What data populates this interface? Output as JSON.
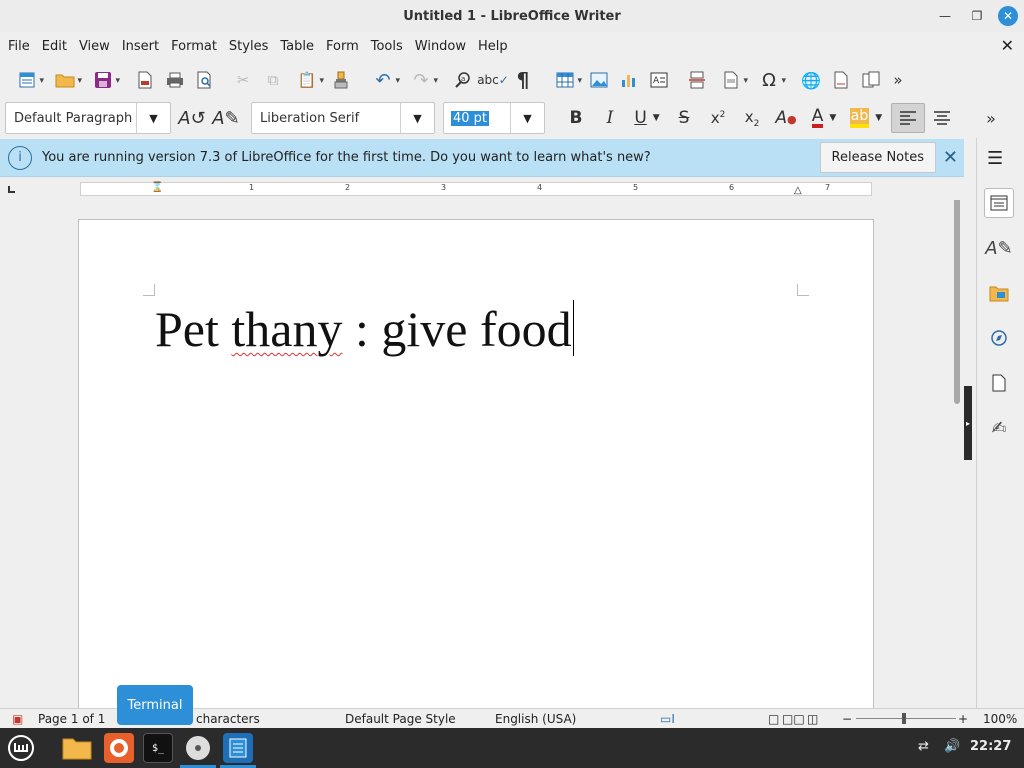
{
  "window": {
    "title": "Untitled 1 - LibreOffice Writer"
  },
  "menu": [
    "File",
    "Edit",
    "View",
    "Insert",
    "Format",
    "Styles",
    "Table",
    "Form",
    "Tools",
    "Window",
    "Help"
  ],
  "toolbar2": {
    "paragraph_style": "Default Paragraph",
    "font_name": "Liberation Serif",
    "font_size": "40 pt"
  },
  "infobar": {
    "message": "You are running version 7.3 of LibreOffice for the first time. Do you want to learn what's new?",
    "button": "Release Notes"
  },
  "ruler": {
    "labels": [
      "1",
      "2",
      "3",
      "4",
      "5",
      "6",
      "7"
    ]
  },
  "document": {
    "text_before": "Pet ",
    "misspelled": "thany",
    "text_after": " : give food"
  },
  "tooltip": "Terminal",
  "statusbar": {
    "page": "Page 1 of 1",
    "words": "characters",
    "page_style": "Default Page Style",
    "language": "English (USA)",
    "zoom": "100%"
  },
  "taskbar": {
    "clock": "22:27"
  },
  "colors": {
    "accent": "#2d8fd8",
    "infobar": "#b9e0f4"
  }
}
